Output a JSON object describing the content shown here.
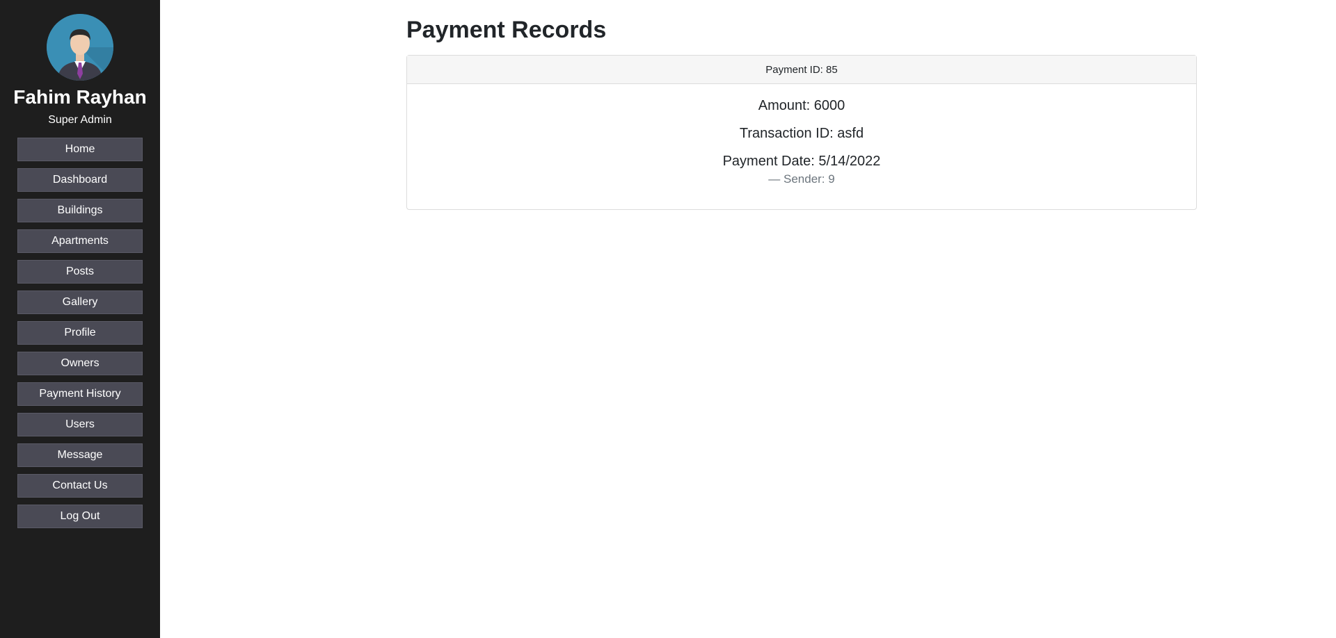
{
  "sidebar": {
    "profile_name": "Fahim Rayhan",
    "profile_role": "Super Admin",
    "items": [
      {
        "label": "Home"
      },
      {
        "label": "Dashboard"
      },
      {
        "label": "Buildings"
      },
      {
        "label": "Apartments"
      },
      {
        "label": "Posts"
      },
      {
        "label": "Gallery"
      },
      {
        "label": "Profile"
      },
      {
        "label": "Owners"
      },
      {
        "label": "Payment History"
      },
      {
        "label": "Users"
      },
      {
        "label": "Message"
      },
      {
        "label": "Contact Us"
      },
      {
        "label": "Log Out"
      }
    ]
  },
  "main": {
    "title": "Payment Records",
    "record": {
      "header": "Payment ID: 85",
      "amount": "Amount: 6000",
      "transaction": "Transaction ID: asfd",
      "date": "Payment Date: 5/14/2022",
      "sender": "— Sender: 9"
    }
  },
  "colors": {
    "sidebar_bg": "#1e1e1e",
    "nav_button_bg": "#4a4a55",
    "avatar_bg": "#3a8fb5",
    "tie": "#8e3fa0"
  }
}
